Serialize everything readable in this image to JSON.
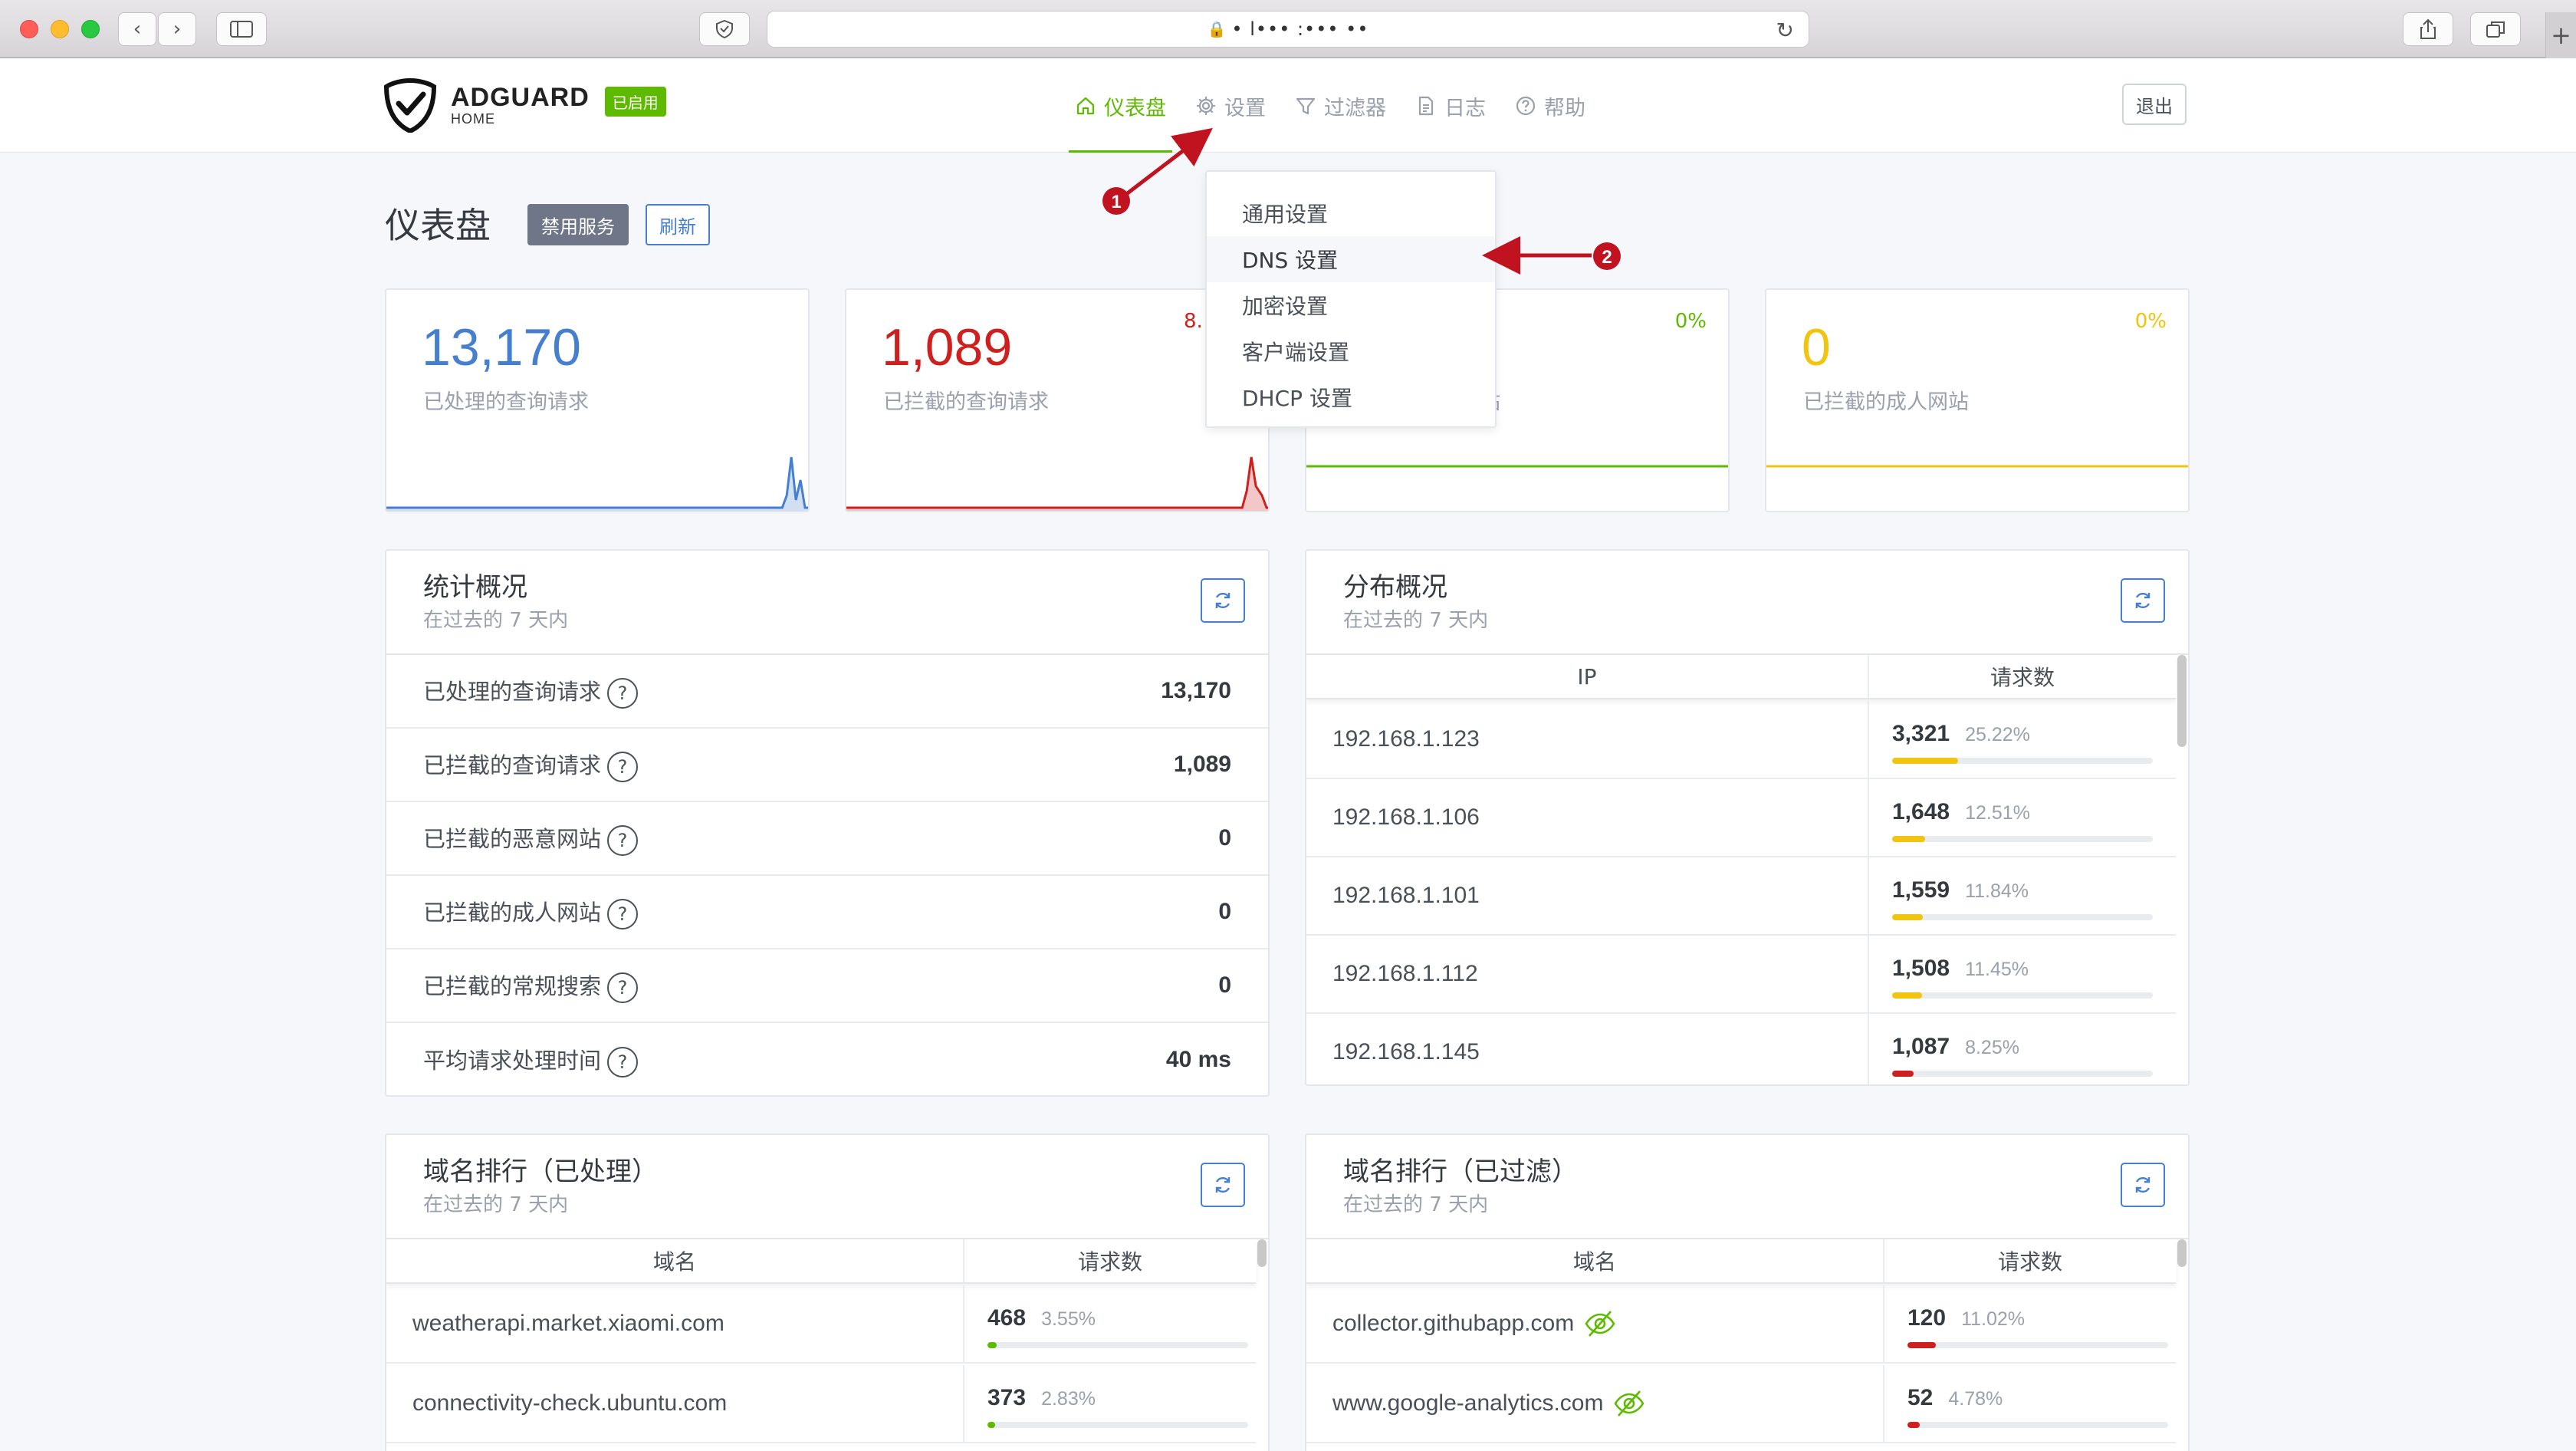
{
  "browser": {
    "address": "• l••• :••• ••"
  },
  "header": {
    "logo_name": "ADGUARD",
    "logo_sub": "HOME",
    "status_badge": "已启用",
    "nav": [
      {
        "label": "仪表盘",
        "icon": "home-icon"
      },
      {
        "label": "设置",
        "icon": "gear-icon"
      },
      {
        "label": "过滤器",
        "icon": "filter-icon"
      },
      {
        "label": "日志",
        "icon": "document-icon"
      },
      {
        "label": "帮助",
        "icon": "help-icon"
      }
    ],
    "logout": "退出"
  },
  "settings_menu": [
    "通用设置",
    "DNS 设置",
    "加密设置",
    "客户端设置",
    "DHCP 设置"
  ],
  "page": {
    "title": "仪表盘",
    "disable_btn": "禁用服务",
    "refresh_btn": "刷新"
  },
  "stats_cards": [
    {
      "value": "13,170",
      "label": "已处理的查询请求",
      "percent": "",
      "color": "#467fcf"
    },
    {
      "value": "1,089",
      "label": "已拦截的查询请求",
      "percent": "8.",
      "color": "#cd201f"
    },
    {
      "value": "",
      "label": "站",
      "percent": "0%",
      "color": "#5eba00"
    },
    {
      "value": "0",
      "label": "已拦截的成人网站",
      "percent": "0%",
      "color": "#f1c40f"
    }
  ],
  "stats_overview": {
    "title": "统计概况",
    "subtitle": "在过去的 7 天内",
    "rows": [
      {
        "label": "已处理的查询请求",
        "value": "13,170"
      },
      {
        "label": "已拦截的查询请求",
        "value": "1,089"
      },
      {
        "label": "已拦截的恶意网站",
        "value": "0"
      },
      {
        "label": "已拦截的成人网站",
        "value": "0"
      },
      {
        "label": "已拦截的常规搜索",
        "value": "0"
      },
      {
        "label": "平均请求处理时间",
        "value": "40 ms"
      }
    ]
  },
  "distribution": {
    "title": "分布概况",
    "subtitle": "在过去的 7 天内",
    "col_ip": "IP",
    "col_count": "请求数",
    "rows": [
      {
        "ip": "192.168.1.123",
        "count": "3,321",
        "pct": "25.22%",
        "fill": 0.2522,
        "color": "#f1c40f"
      },
      {
        "ip": "192.168.1.106",
        "count": "1,648",
        "pct": "12.51%",
        "fill": 0.1251,
        "color": "#f1c40f"
      },
      {
        "ip": "192.168.1.101",
        "count": "1,559",
        "pct": "11.84%",
        "fill": 0.1184,
        "color": "#f1c40f"
      },
      {
        "ip": "192.168.1.112",
        "count": "1,508",
        "pct": "11.45%",
        "fill": 0.1145,
        "color": "#f1c40f"
      },
      {
        "ip": "192.168.1.145",
        "count": "1,087",
        "pct": "8.25%",
        "fill": 0.0825,
        "color": "#cd201f"
      }
    ]
  },
  "top_domains": {
    "title": "域名排行（已处理）",
    "subtitle": "在过去的 7 天内",
    "col_domain": "域名",
    "col_count": "请求数",
    "rows": [
      {
        "domain": "weatherapi.market.xiaomi.com",
        "count": "468",
        "pct": "3.55%",
        "fill": 0.0355,
        "color": "#5eba00"
      },
      {
        "domain": "connectivity-check.ubuntu.com",
        "count": "373",
        "pct": "2.83%",
        "fill": 0.0283,
        "color": "#5eba00"
      }
    ]
  },
  "top_blocked": {
    "title": "域名排行（已过滤）",
    "subtitle": "在过去的 7 天内",
    "col_domain": "域名",
    "col_count": "请求数",
    "rows": [
      {
        "domain": "collector.githubapp.com",
        "count": "120",
        "pct": "11.02%",
        "fill": 0.1102,
        "color": "#cd201f"
      },
      {
        "domain": "www.google-analytics.com",
        "count": "52",
        "pct": "4.78%",
        "fill": 0.0478,
        "color": "#cd201f"
      }
    ]
  },
  "annotations": [
    "1",
    "2"
  ],
  "colors": {
    "accent_green": "#5eba00",
    "accent_blue": "#467fcf",
    "danger": "#cd201f",
    "warning": "#f1c40f",
    "annotation": "#c1121f"
  }
}
